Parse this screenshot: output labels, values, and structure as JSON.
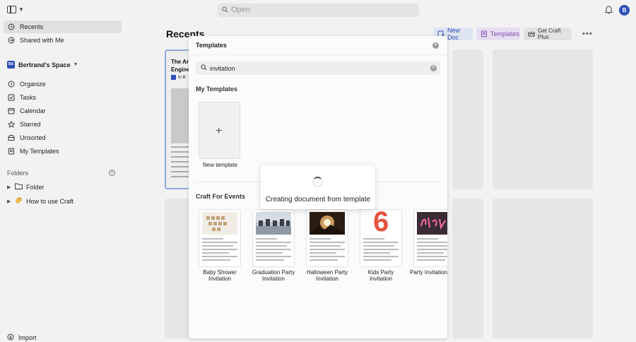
{
  "topbar": {
    "search_placeholder": "Open",
    "avatar_initial": "B"
  },
  "sidebar": {
    "top_items": [
      {
        "label": "Recents",
        "icon": "clock-icon",
        "active": true
      },
      {
        "label": "Shared with Me",
        "icon": "share-icon"
      }
    ],
    "space": {
      "badge": "BS",
      "name": "Bertrand's Space"
    },
    "items": [
      {
        "label": "Organize",
        "icon": "organize-icon"
      },
      {
        "label": "Tasks",
        "icon": "checkbox-icon"
      },
      {
        "label": "Calendar",
        "icon": "calendar-icon"
      },
      {
        "label": "Starred",
        "icon": "star-icon"
      },
      {
        "label": "Unsorted",
        "icon": "unsorted-icon"
      },
      {
        "label": "My Templates",
        "icon": "template-icon"
      }
    ],
    "folders_label": "Folders",
    "tree": [
      {
        "label": "Folder",
        "icon": "folder-icon"
      },
      {
        "label": "How to use Craft",
        "icon": "wave-emoji-icon"
      }
    ],
    "import_label": "Import"
  },
  "main": {
    "title": "Recents",
    "buttons": {
      "new_doc": "New Doc",
      "templates": "Templates",
      "get_plus": "Get Craft Plus"
    },
    "doc_card": {
      "title_line1": "The Ar",
      "title_line2": "Engine",
      "in_label": "In B"
    }
  },
  "modal": {
    "title": "Templates",
    "search_value": "invitation",
    "my_templates_label": "My Templates",
    "new_template_label": "New template",
    "events_label": "Craft For Events",
    "templates": [
      {
        "label_line1": "Baby Shower",
        "label_line2": "Invitation"
      },
      {
        "label_line1": "Graduation Party",
        "label_line2": "Invitation"
      },
      {
        "label_line1": "Halloween Party",
        "label_line2": "Invitation"
      },
      {
        "label_line1": "Kids Party",
        "label_line2": "Invitation"
      },
      {
        "label_line1": "Party Invitation",
        "label_line2": ""
      }
    ],
    "kids_number": "6"
  },
  "toast": {
    "text": "Creating document from template"
  },
  "colors": {
    "accent": "#2e4fb7",
    "templates_purple": "#7a4fb0"
  }
}
